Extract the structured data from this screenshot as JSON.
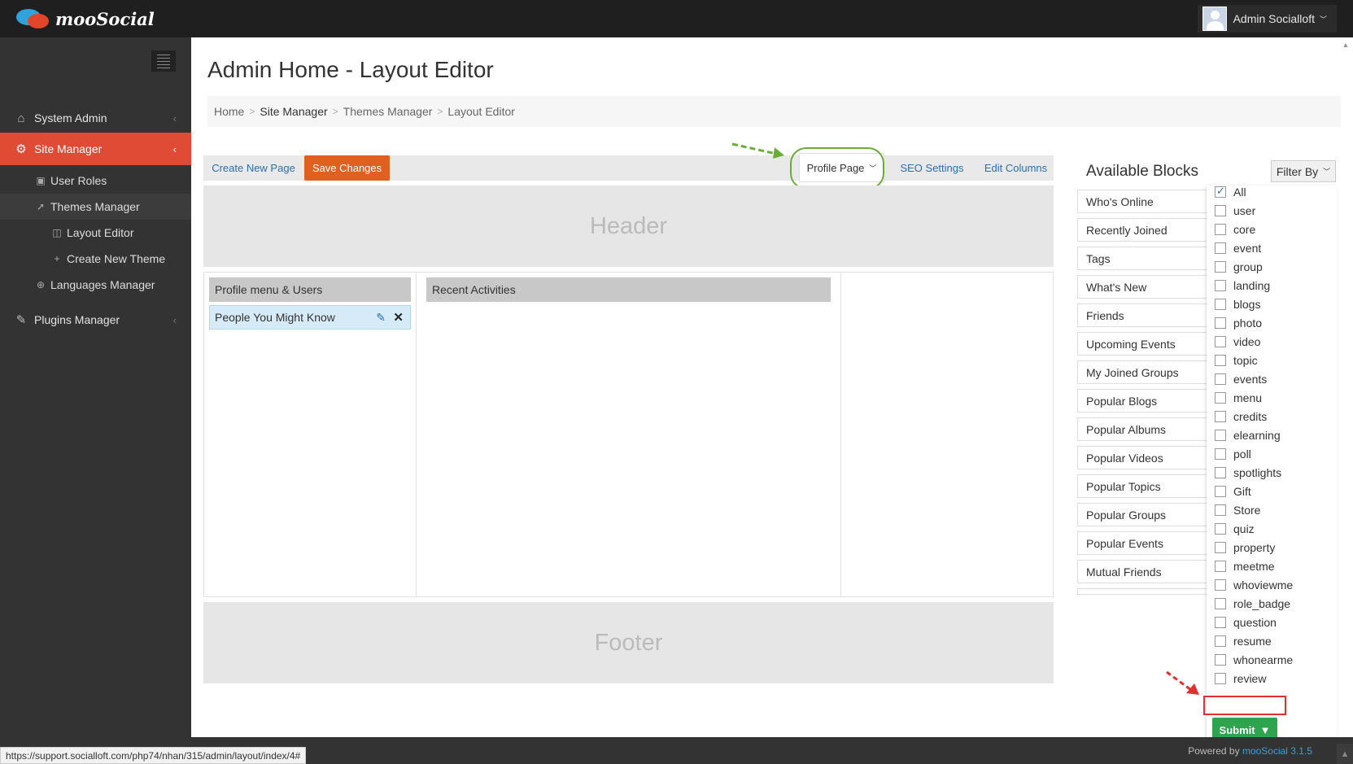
{
  "app": {
    "brand": "mooSocial",
    "user_name": "Admin Socialloft"
  },
  "sidebar": {
    "items": [
      {
        "label": "System Admin",
        "icon": "home-icon"
      },
      {
        "label": "Site Manager",
        "icon": "gears-icon"
      },
      {
        "label": "User Roles",
        "icon": "briefcase-icon"
      },
      {
        "label": "Themes Manager",
        "icon": "rocket-icon"
      },
      {
        "label": "Layout Editor",
        "icon": "columns-icon"
      },
      {
        "label": "Create New Theme",
        "icon": "plus-icon"
      },
      {
        "label": "Languages Manager",
        "icon": "globe-icon"
      },
      {
        "label": "Plugins Manager",
        "icon": "plugin-icon"
      }
    ]
  },
  "page": {
    "title": "Admin Home - Layout Editor",
    "breadcrumb": [
      "Home",
      "Site Manager",
      "Themes Manager",
      "Layout Editor"
    ]
  },
  "toolbar": {
    "create_label": "Create New Page",
    "save_label": "Save Changes",
    "profile_label": "Profile Page",
    "seo_label": "SEO Settings",
    "edit_columns_label": "Edit Columns"
  },
  "layout": {
    "header_label": "Header",
    "footer_label": "Footer",
    "left_column_title": "Profile menu & Users",
    "left_block": "People You Might Know",
    "center_column_title": "Recent Activities"
  },
  "available": {
    "title": "Available Blocks",
    "filter_label": "Filter By",
    "blocks": [
      "Who's Online",
      "Recently Joined",
      "Tags",
      "What's New",
      "Friends",
      "Upcoming Events",
      "My Joined Groups",
      "Popular Blogs",
      "Popular Albums",
      "Popular Videos",
      "Popular Topics",
      "Popular Groups",
      "Popular Events",
      "Mutual Friends"
    ]
  },
  "filter": {
    "options": [
      "All",
      "user",
      "core",
      "event",
      "group",
      "landing",
      "blogs",
      "photo",
      "video",
      "topic",
      "events",
      "menu",
      "credits",
      "elearning",
      "poll",
      "spotlights",
      "Gift",
      "Store",
      "quiz",
      "property",
      "meetme",
      "whoviewme",
      "role_badge",
      "question",
      "resume",
      "whonearme",
      "review"
    ],
    "checked": [
      "All"
    ],
    "submit_label": "Submit"
  },
  "footer": {
    "powered_prefix": "Powered by",
    "powered_link": "mooSocial 3.1.5",
    "status_url": "https://support.socialloft.com/php74/nhan/315/admin/layout/index/4#"
  },
  "colors": {
    "accent": "#e04b35",
    "save": "#e0601f",
    "submit": "#2ea44f",
    "link": "#2c6fad"
  }
}
